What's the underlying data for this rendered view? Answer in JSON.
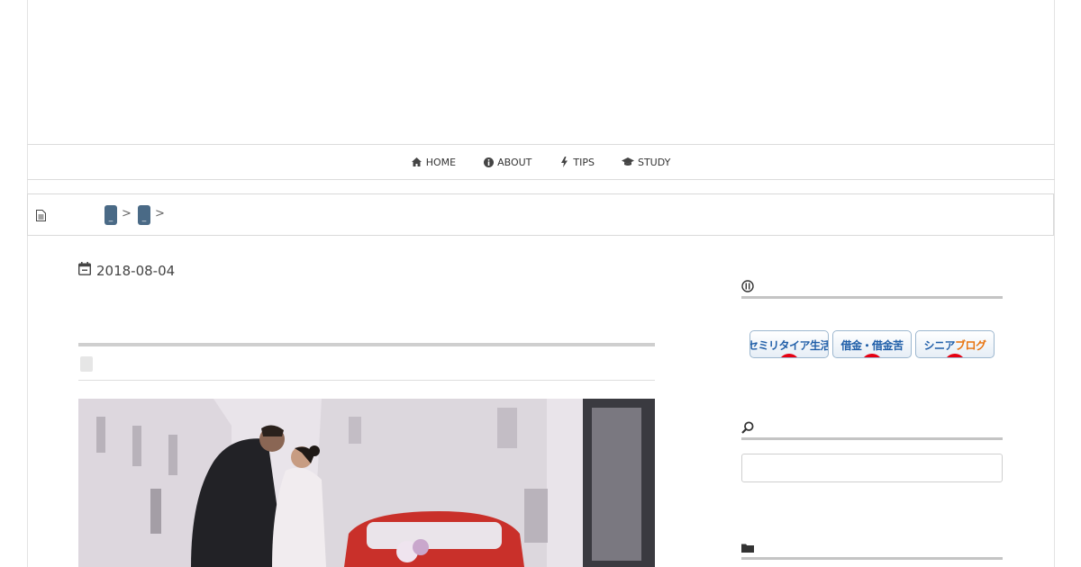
{
  "nav": {
    "items": [
      {
        "label": "HOME",
        "icon": "home-icon"
      },
      {
        "label": "ABOUT",
        "icon": "info-icon"
      },
      {
        "label": "TIPS",
        "icon": "bolt-icon"
      },
      {
        "label": "STUDY",
        "icon": "graduation-cap-icon"
      }
    ]
  },
  "breadcrumb": {
    "icon": "document-icon",
    "chips": [
      {
        "label": "_"
      },
      {
        "label": "_"
      }
    ],
    "separator": ">"
  },
  "post": {
    "date": "2018-08-04",
    "date_icon": "calendar-icon",
    "hero_image": "wedding-couple-kissing-by-red-car-photo"
  },
  "sidebar": {
    "ranking_icon": "ranking-icon",
    "banners": [
      {
        "label_main": "セミリタイア生活",
        "label_accent": ""
      },
      {
        "label_main": "借金・借金苦",
        "label_accent": ""
      },
      {
        "label_main": "シニア",
        "label_accent": "ブログ"
      }
    ],
    "search_icon": "search-icon",
    "search": {
      "value": "",
      "placeholder": ""
    },
    "category_icon": "folder-icon"
  },
  "colors": {
    "chip": "#4a6a86",
    "rule": "#c4c4c4",
    "banner_text": "#1f5ea8",
    "banner_accent": "#e8720c",
    "banner_badge": "#e60012"
  }
}
